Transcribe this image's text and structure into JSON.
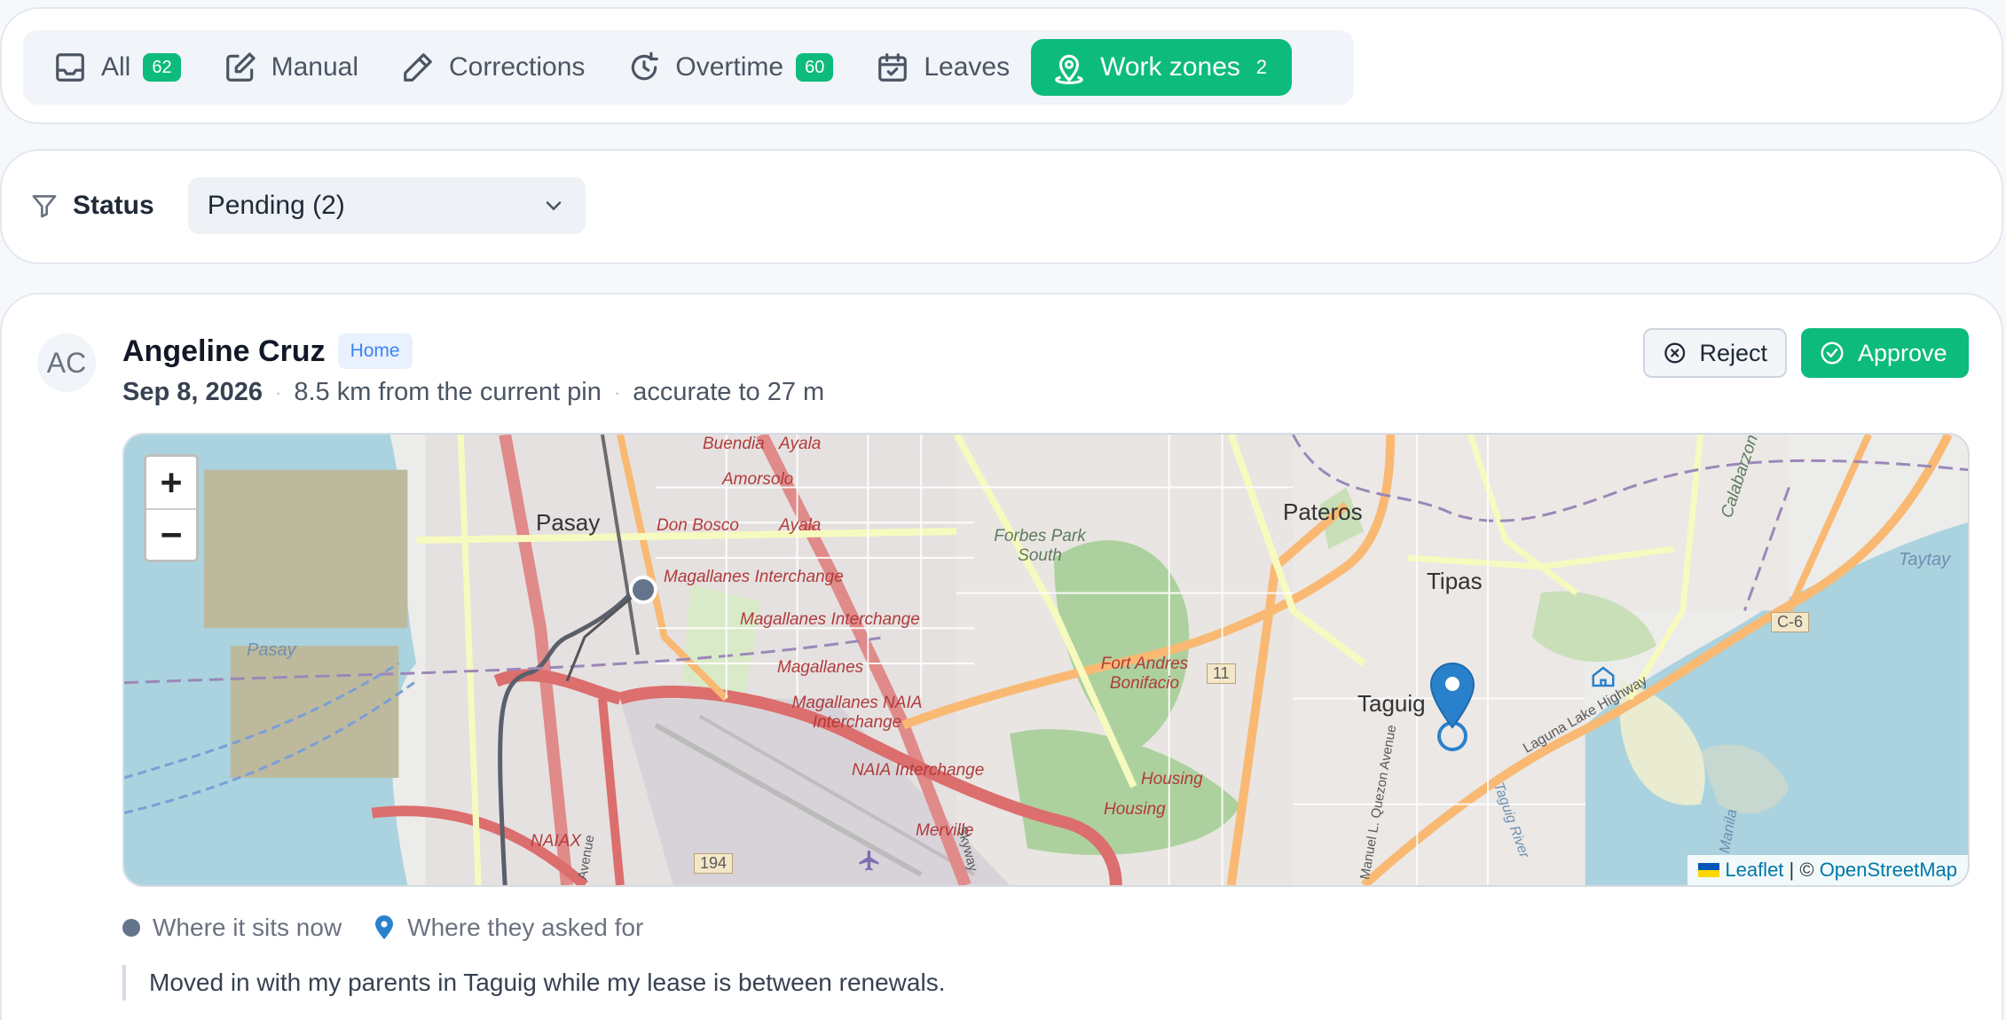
{
  "tabs": [
    {
      "label": "All",
      "count": "62",
      "icon": "inbox-icon"
    },
    {
      "label": "Manual",
      "count": "",
      "icon": "edit-icon"
    },
    {
      "label": "Corrections",
      "count": "",
      "icon": "pencil-icon"
    },
    {
      "label": "Overtime",
      "count": "60",
      "icon": "clock-rotate-icon"
    },
    {
      "label": "Leaves",
      "count": "",
      "icon": "calendar-check-icon"
    },
    {
      "label": "Work zones",
      "count": "2",
      "icon": "map-pin-icon",
      "active": true
    }
  ],
  "filter": {
    "label": "Status",
    "selected": "Pending (2)"
  },
  "request": {
    "initials": "AC",
    "name": "Angeline Cruz",
    "badge": "Home",
    "date": "Sep 8, 2026",
    "distance": "8.5 km from the current pin",
    "accuracy": "accurate to 27 m",
    "reject_label": "Reject",
    "approve_label": "Approve",
    "legend_current": "Where it sits now",
    "legend_requested": "Where they asked for",
    "note": "Moved in with my parents in Taguig while my lease is between renewals."
  },
  "map": {
    "zoom_in": "+",
    "zoom_out": "−",
    "attribution_leaflet": "Leaflet",
    "attribution_sep": " | © ",
    "attribution_osm": "OpenStreetMap",
    "labels": {
      "pasay_city": "Pasay",
      "pasay_water": "Pasay",
      "pateros": "Pateros",
      "tipas": "Tipas",
      "taguig": "Taguig",
      "amorsolo": "Amorsolo",
      "don_bosco": "Don Bosco",
      "ayala": "Ayala",
      "ayala_top": "Ayala",
      "buendia": "Buendia",
      "forbes": "Forbes Park South",
      "magallanes_int_1": "Magallanes Interchange",
      "magallanes_int_2": "Magallanes Interchange",
      "magallanes": "Magallanes",
      "magallanes_naia": "Magallanes NAIA Interchange",
      "naia_int": "NAIA Interchange",
      "fort_andres": "Fort Andres Bonifacio",
      "housing_1": "Housing",
      "housing_2": "Housing",
      "merville": "Merville",
      "naiax": "NAIAX",
      "r194": "194",
      "r11": "11",
      "c6": "C-6",
      "calabarzon": "Calabarzon",
      "taytay": "Taytay",
      "laguna_lake_hwy": "Laguna Lake Highway",
      "quezon_ave": "Manuel L. Quezon Avenue",
      "taguig_river": "Taguig River",
      "manila": "Manila",
      "avenue": "Avenue",
      "skyway": "Skyway"
    }
  },
  "colors": {
    "accent": "#0dbb7d",
    "badge_bg": "#e8f1fd",
    "badge_text": "#3b82f6",
    "current_pin": "#64748b",
    "requested_pin": "#2a81cb"
  }
}
